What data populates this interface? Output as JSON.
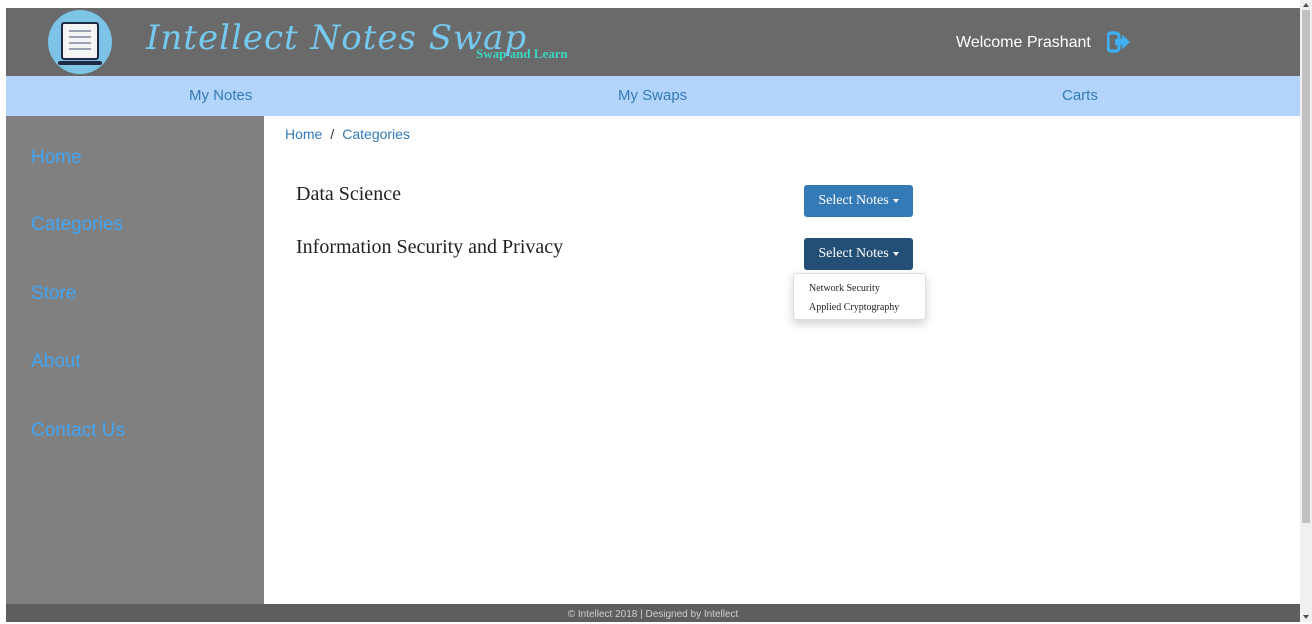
{
  "header": {
    "brand_title": "Intellect Notes Swap",
    "brand_tagline": "Swap and Learn",
    "welcome_text": "Welcome Prashant",
    "logo_icon": "notebook-icon",
    "logout_icon": "logout-icon"
  },
  "topnav": {
    "items": [
      {
        "label": "My Notes"
      },
      {
        "label": "My Swaps"
      },
      {
        "label": "Carts"
      }
    ]
  },
  "sidebar": {
    "items": [
      {
        "label": "Home"
      },
      {
        "label": "Categories"
      },
      {
        "label": "Store"
      },
      {
        "label": "About"
      },
      {
        "label": "Contact Us"
      }
    ]
  },
  "breadcrumb": {
    "items": [
      {
        "label": "Home"
      },
      {
        "label": "Categories"
      }
    ],
    "separator": "/"
  },
  "categories": [
    {
      "name": "Data Science",
      "button_label": "Select Notes"
    },
    {
      "name": "Information Security and Privacy",
      "button_label": "Select Notes"
    }
  ],
  "dropdown": {
    "open": true,
    "items": [
      {
        "label": "Network Security"
      },
      {
        "label": "Applied Cryptography"
      }
    ]
  },
  "footer": {
    "text": "© Intellect 2018 | Designed by Intellect"
  },
  "colors": {
    "header_bg": "#6a6a6a",
    "brand": "#76c9ee",
    "tagline": "#3dd6c2",
    "topnav_bg": "#b3d4fb",
    "sidebar_bg": "#808080",
    "sidebar_link": "#42a5f5",
    "button_primary": "#337ab7",
    "button_active": "#234f77"
  }
}
